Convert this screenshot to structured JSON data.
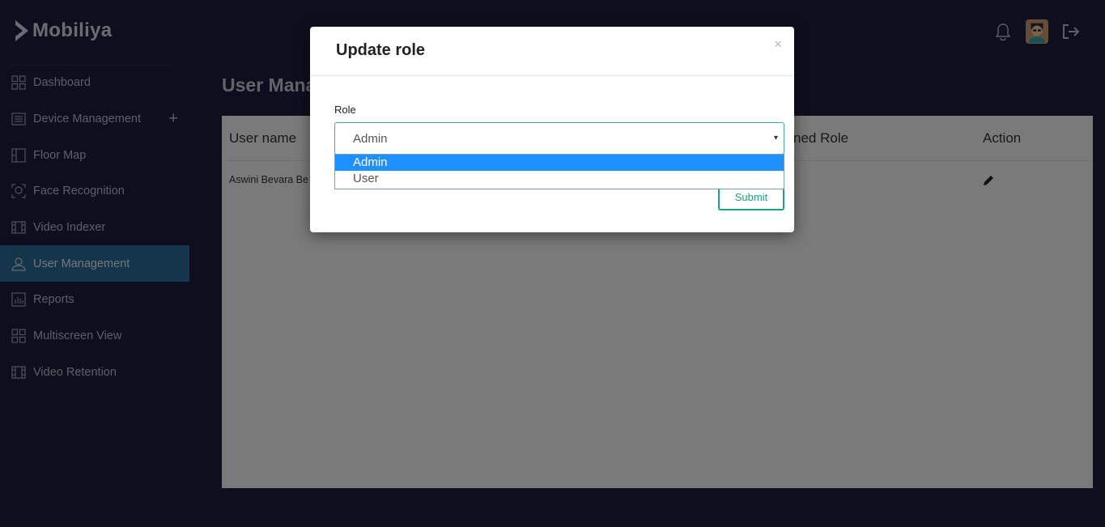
{
  "app": {
    "brand": "Mobiliya"
  },
  "sidebar": {
    "items": [
      {
        "label": "Dashboard",
        "icon": "grid-icon"
      },
      {
        "label": "Device Management",
        "icon": "list-icon",
        "expand": "+"
      },
      {
        "label": "Floor Map",
        "icon": "floor-map-icon"
      },
      {
        "label": "Face Recognition",
        "icon": "face-scan-icon"
      },
      {
        "label": "Video Indexer",
        "icon": "film-icon"
      },
      {
        "label": "User Management",
        "icon": "user-icon",
        "active": true
      },
      {
        "label": "Reports",
        "icon": "bar-chart-icon"
      },
      {
        "label": "Multiscreen View",
        "icon": "grid-icon"
      },
      {
        "label": "Video Retention",
        "icon": "film-icon"
      }
    ]
  },
  "topbar": {
    "icons": [
      "bell-icon",
      "avatar",
      "logout-icon"
    ]
  },
  "main": {
    "page_title": "User Mana",
    "table": {
      "columns": [
        "User name",
        "ned Role",
        "Action"
      ],
      "rows": [
        {
          "user_name": "Aswini Bevara Be"
        }
      ]
    }
  },
  "modal": {
    "title": "Update role",
    "close": "×",
    "role_label": "Role",
    "role_value": "Admin",
    "caret": "▾",
    "options": [
      "Admin",
      "User"
    ],
    "submit_label": "Submit"
  },
  "colors": {
    "background": "#1b1e3d",
    "active_nav": "#2b6a96",
    "accent": "#1ea184",
    "option_highlight": "#1e90ff"
  }
}
